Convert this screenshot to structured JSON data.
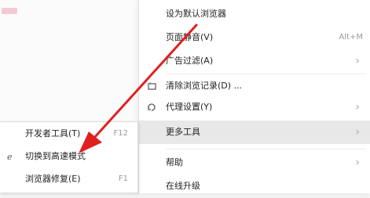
{
  "main_menu": {
    "items": [
      {
        "label": "设为默认浏览器",
        "shortcut": "",
        "submenu": false,
        "icon": ""
      },
      {
        "label": "页面静音(V)",
        "shortcut": "Alt+M",
        "submenu": false,
        "icon": ""
      },
      {
        "label": "广告过滤(A)",
        "shortcut": "",
        "submenu": true,
        "icon": ""
      },
      {
        "label": "清除浏览记录(D) ...",
        "shortcut": "",
        "submenu": false,
        "icon": "broom-icon"
      },
      {
        "label": "代理设置(Y)",
        "shortcut": "",
        "submenu": true,
        "icon": "proxy-icon"
      },
      {
        "label": "更多工具",
        "shortcut": "",
        "submenu": true,
        "icon": "",
        "highlighted": true
      },
      {
        "label": "帮助",
        "shortcut": "",
        "submenu": true,
        "icon": ""
      },
      {
        "label": "在线升级",
        "shortcut": "",
        "submenu": false,
        "icon": ""
      }
    ]
  },
  "sub_menu": {
    "items": [
      {
        "label": "开发者工具(T)",
        "shortcut": "F12",
        "icon": ""
      },
      {
        "label": "切换到高速模式",
        "shortcut": "",
        "icon": "ie-icon"
      },
      {
        "label": "浏览器修复(E)",
        "shortcut": "F1",
        "icon": ""
      }
    ]
  },
  "annotation": {
    "color": "#e02020",
    "icon": "red-arrow-icon"
  }
}
